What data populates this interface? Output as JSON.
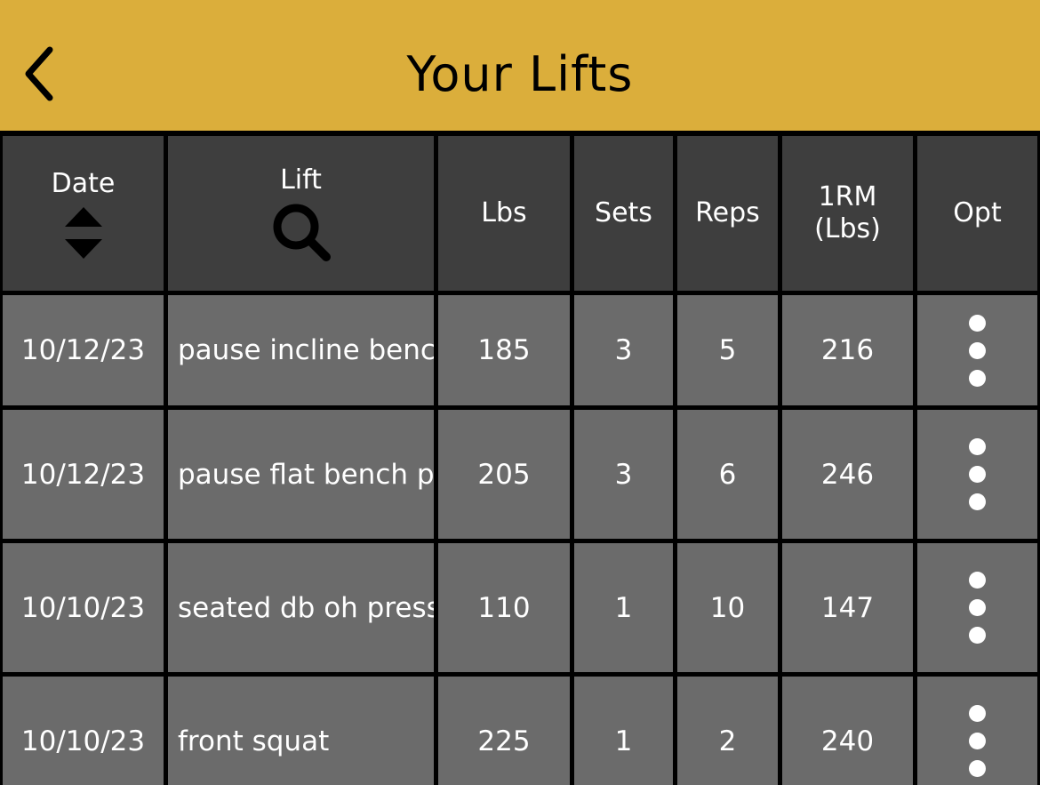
{
  "header": {
    "title": "Your Lifts"
  },
  "columns": {
    "date": "Date",
    "lift": "Lift",
    "lbs": "Lbs",
    "sets": "Sets",
    "reps": "Reps",
    "orm_line1": "1RM",
    "orm_line2": "(Lbs)",
    "opt": "Opt"
  },
  "rows": [
    {
      "date": "10/12/23",
      "lift": "pause incline bench press",
      "lbs": "185",
      "sets": "3",
      "reps": "5",
      "orm": "216"
    },
    {
      "date": "10/12/23",
      "lift": "pause flat bench press",
      "lbs": "205",
      "sets": "3",
      "reps": "6",
      "orm": "246"
    },
    {
      "date": "10/10/23",
      "lift": "seated db oh press",
      "lbs": "110",
      "sets": "1",
      "reps": "10",
      "orm": "147"
    },
    {
      "date": "10/10/23",
      "lift": "front squat",
      "lbs": "225",
      "sets": "1",
      "reps": "2",
      "orm": "240"
    }
  ],
  "colors": {
    "header_bg": "#DBAE3B",
    "table_header_bg": "#3E3E3E",
    "row_bg": "#6B6B6B",
    "grid": "#000000",
    "text": "#FFFFFF"
  },
  "icons": {
    "back": "chevron-left-icon",
    "sort": "sort-icon",
    "search": "search-icon",
    "options": "more-vertical-icon"
  }
}
